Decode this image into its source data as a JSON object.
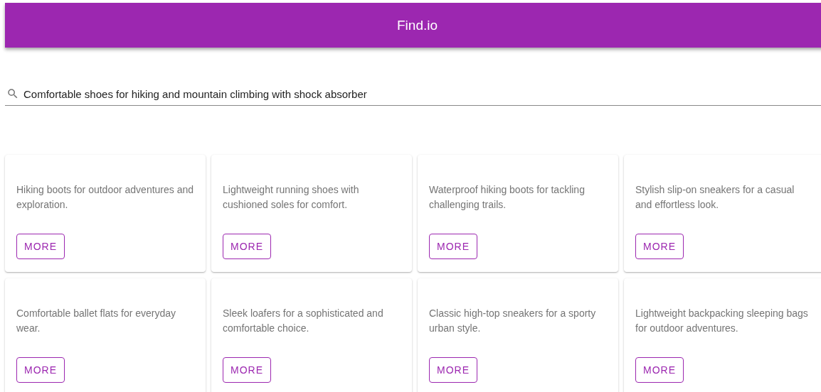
{
  "app_bar": {
    "title": "Find.io"
  },
  "search": {
    "value": "Comfortable shoes for hiking and mountain climbing with shock absorber"
  },
  "cards": [
    {
      "description": "Hiking boots for outdoor adventures and exploration.",
      "button": "MORE"
    },
    {
      "description": "Lightweight running shoes with cushioned soles for comfort.",
      "button": "MORE"
    },
    {
      "description": "Waterproof hiking boots for tackling challenging trails.",
      "button": "MORE"
    },
    {
      "description": "Stylish slip-on sneakers for a casual and effortless look.",
      "button": "MORE"
    },
    {
      "description": "Comfortable ballet flats for everyday wear.",
      "button": "MORE"
    },
    {
      "description": "Sleek loafers for a sophisticated and comfortable choice.",
      "button": "MORE"
    },
    {
      "description": "Classic high-top sneakers for a sporty urban style.",
      "button": "MORE"
    },
    {
      "description": "Lightweight backpacking sleeping bags for outdoor adventures.",
      "button": "MORE"
    }
  ]
}
